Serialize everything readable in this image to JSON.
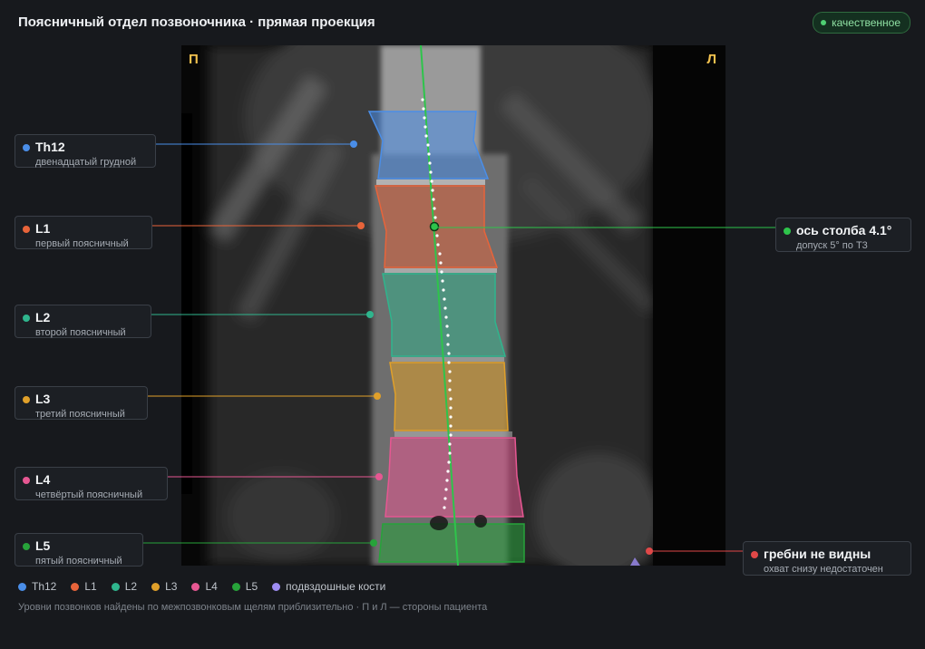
{
  "header": {
    "title": "Поясничный отдел позвоночника · прямая проекция",
    "badge": "качественное",
    "badge_color": "#4fd073"
  },
  "viewer": {
    "left_mark": "П",
    "right_mark": "Л"
  },
  "vertebrae": [
    {
      "id": "th12",
      "name": "Th12",
      "desc": "двенадцатый грудной",
      "color": "#4a8ee8"
    },
    {
      "id": "l1",
      "name": "L1",
      "desc": "первый поясничный",
      "color": "#e8643a"
    },
    {
      "id": "l2",
      "name": "L2",
      "desc": "второй поясничный",
      "color": "#2fb58d"
    },
    {
      "id": "l3",
      "name": "L3",
      "desc": "третий поясничный",
      "color": "#e0a02a"
    },
    {
      "id": "l4",
      "name": "L4",
      "desc": "четвёртый поясничный",
      "color": "#e65792"
    },
    {
      "id": "l5",
      "name": "L5",
      "desc": "пятый поясничный",
      "color": "#27a33a"
    }
  ],
  "axis_card": {
    "title": "ось столба 4.1°",
    "subtitle": "допуск 5° по Т3",
    "color": "#2ec44b"
  },
  "iliac_card": {
    "title": "гребни не видны",
    "subtitle": "охват снизу недостаточен",
    "color": "#e04848"
  },
  "legend": [
    {
      "label": "Th12",
      "color": "#4a8ee8"
    },
    {
      "label": "L1",
      "color": "#e8643a"
    },
    {
      "label": "L2",
      "color": "#2fb58d"
    },
    {
      "label": "L3",
      "color": "#e0a02a"
    },
    {
      "label": "L4",
      "color": "#e65792"
    },
    {
      "label": "L5",
      "color": "#27a33a"
    },
    {
      "label": "подвздошные кости",
      "color": "#9d8cf2"
    }
  ],
  "footer_note": "Уровни позвонков найдены по межпозвонковым щелям приблизительно · П и Л — стороны пациента"
}
